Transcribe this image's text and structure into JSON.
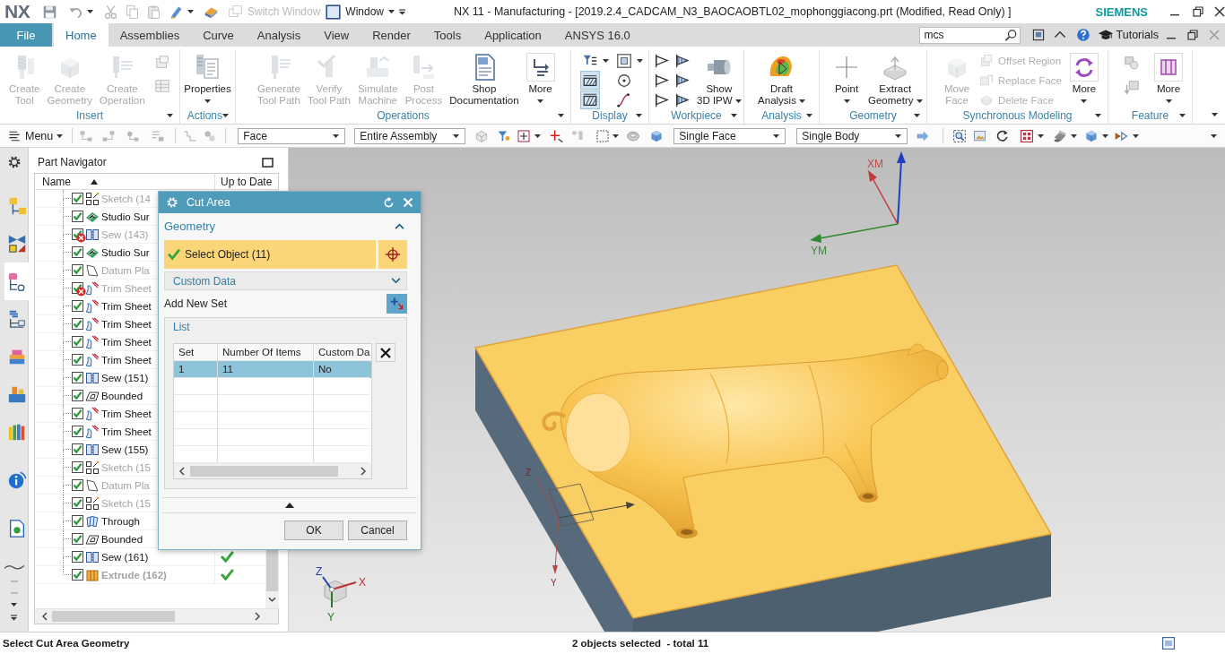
{
  "title_bar": {
    "logo": "NX",
    "switch_window": {
      "label": "Switch Window",
      "disabled": true
    },
    "window_menu": "Window",
    "title": "NX 11 - Manufacturing - [2019.2.4_CADCAM_N3_BAOCAOBTL02_mophonggiacong.prt (Modified, Read Only) ]",
    "brand": "SIEMENS"
  },
  "menu_tabs": [
    {
      "label": "File",
      "kind": "file",
      "selected": false
    },
    {
      "label": "Home",
      "kind": "tab",
      "selected": true
    },
    {
      "label": "Assemblies",
      "kind": "tab",
      "selected": false
    },
    {
      "label": "Curve",
      "kind": "tab",
      "selected": false
    },
    {
      "label": "Analysis",
      "kind": "tab",
      "selected": false
    },
    {
      "label": "View",
      "kind": "tab",
      "selected": false
    },
    {
      "label": "Render",
      "kind": "tab",
      "selected": false
    },
    {
      "label": "Tools",
      "kind": "tab",
      "selected": false
    },
    {
      "label": "Application",
      "kind": "tab",
      "selected": false
    },
    {
      "label": "ANSYS 16.0",
      "kind": "tab",
      "selected": false
    }
  ],
  "command_search": {
    "value": "mcs"
  },
  "help_bar": {
    "tutorials": "Tutorials"
  },
  "ribbon": {
    "groups": [
      {
        "label": "Insert",
        "buttons": [
          {
            "label": "Create\nTool",
            "kind": "large",
            "disabled": true
          },
          {
            "label": "Create\nGeometry",
            "kind": "large",
            "disabled": true
          },
          {
            "label": "Create\nOperation",
            "kind": "large",
            "disabled": true
          }
        ]
      },
      {
        "label": "Actions",
        "buttons": [
          {
            "label": "Properties",
            "kind": "large",
            "disabled": false
          }
        ]
      },
      {
        "label": "Operations",
        "buttons": [
          {
            "label": "Generate\nTool Path",
            "kind": "large",
            "disabled": true
          },
          {
            "label": "Verify\nTool Path",
            "kind": "large",
            "disabled": true
          },
          {
            "label": "Simulate\nMachine",
            "kind": "large",
            "disabled": true
          },
          {
            "label": "Post\nProcess",
            "kind": "large",
            "disabled": true
          },
          {
            "label": "Shop\nDocumentation",
            "kind": "large",
            "disabled": false
          },
          {
            "label": "More",
            "kind": "large",
            "disabled": false
          }
        ]
      },
      {
        "label": "Display",
        "toggles": [
          {
            "on": false
          },
          {
            "on": false
          },
          {
            "on": true
          },
          {
            "on": false
          },
          {
            "on": true
          },
          {
            "on": false
          }
        ]
      },
      {
        "label": "Workpiece",
        "buttons": [
          {
            "label": "Show\n3D IPW",
            "kind": "large",
            "disabled": false
          }
        ]
      },
      {
        "label": "Analysis",
        "buttons": [
          {
            "label": "Draft\nAnalysis",
            "kind": "large",
            "disabled": false
          }
        ]
      },
      {
        "label": "Geometry",
        "buttons": [
          {
            "label": "Point",
            "kind": "large",
            "disabled": false
          },
          {
            "label": "Extract\nGeometry",
            "kind": "large",
            "disabled": false
          }
        ]
      },
      {
        "label": "Synchronous Modeling",
        "buttons": [
          {
            "label": "Move\nFace",
            "kind": "large",
            "disabled": true
          },
          {
            "label": "Offset Region",
            "kind": "small",
            "disabled": true
          },
          {
            "label": "Replace Face",
            "kind": "small",
            "disabled": true
          },
          {
            "label": "Delete Face",
            "kind": "small",
            "disabled": true
          },
          {
            "label": "More",
            "kind": "large",
            "disabled": false
          }
        ]
      },
      {
        "label": "Feature",
        "buttons": [
          {
            "label": "More",
            "kind": "large",
            "disabled": false
          }
        ]
      }
    ]
  },
  "selection_bar": {
    "menu": "Menu",
    "filters": [
      "Face",
      "Entire Assembly",
      "Single Face",
      "Single Body"
    ]
  },
  "resource_bar": {
    "tabs": [
      {
        "selected": false
      },
      {
        "selected": false
      },
      {
        "selected": true
      },
      {
        "selected": false
      },
      {
        "selected": false
      },
      {
        "selected": false
      },
      {
        "selected": false
      },
      {
        "selected": false
      },
      {
        "selected": false
      }
    ]
  },
  "part_navigator": {
    "title": "Part Navigator",
    "columns": [
      {
        "label": "Name",
        "sorted": true
      },
      {
        "label": "Up to Date",
        "sorted": false
      }
    ],
    "rows": [
      {
        "name": "Sketch (14",
        "kind": "sketch",
        "checked": true,
        "error": false,
        "dimmed": true,
        "current": false,
        "up_to_date": false
      },
      {
        "name": "Studio Sur",
        "kind": "studio-surface",
        "checked": true,
        "error": false,
        "dimmed": false,
        "current": false,
        "up_to_date": false
      },
      {
        "name": "Sew (143)",
        "kind": "sew",
        "checked": true,
        "error": true,
        "dimmed": true,
        "current": false,
        "up_to_date": false
      },
      {
        "name": "Studio Sur",
        "kind": "studio-surface",
        "checked": true,
        "error": false,
        "dimmed": false,
        "current": false,
        "up_to_date": false
      },
      {
        "name": "Datum Pla",
        "kind": "datum-plane",
        "checked": true,
        "error": false,
        "dimmed": true,
        "current": false,
        "up_to_date": false
      },
      {
        "name": "Trim Sheet",
        "kind": "trim-sheet",
        "checked": true,
        "error": true,
        "dimmed": true,
        "current": false,
        "up_to_date": false
      },
      {
        "name": "Trim Sheet",
        "kind": "trim-sheet",
        "checked": true,
        "error": false,
        "dimmed": false,
        "current": false,
        "up_to_date": false
      },
      {
        "name": "Trim Sheet",
        "kind": "trim-sheet",
        "checked": true,
        "error": false,
        "dimmed": false,
        "current": false,
        "up_to_date": false
      },
      {
        "name": "Trim Sheet",
        "kind": "trim-sheet",
        "checked": true,
        "error": false,
        "dimmed": false,
        "current": false,
        "up_to_date": false
      },
      {
        "name": "Trim Sheet",
        "kind": "trim-sheet",
        "checked": true,
        "error": false,
        "dimmed": false,
        "current": false,
        "up_to_date": false
      },
      {
        "name": "Sew (151)",
        "kind": "sew",
        "checked": true,
        "error": false,
        "dimmed": false,
        "current": false,
        "up_to_date": false
      },
      {
        "name": "Bounded",
        "kind": "bounded-plane",
        "checked": true,
        "error": false,
        "dimmed": false,
        "current": false,
        "up_to_date": false
      },
      {
        "name": "Trim Sheet",
        "kind": "trim-sheet",
        "checked": true,
        "error": false,
        "dimmed": false,
        "current": false,
        "up_to_date": false
      },
      {
        "name": "Trim Sheet",
        "kind": "trim-sheet",
        "checked": true,
        "error": false,
        "dimmed": false,
        "current": false,
        "up_to_date": false
      },
      {
        "name": "Sew (155)",
        "kind": "sew",
        "checked": true,
        "error": false,
        "dimmed": false,
        "current": false,
        "up_to_date": false
      },
      {
        "name": "Sketch (15",
        "kind": "sketch",
        "checked": true,
        "error": false,
        "dimmed": true,
        "current": false,
        "up_to_date": false
      },
      {
        "name": "Datum Pla",
        "kind": "datum-plane",
        "checked": true,
        "error": false,
        "dimmed": true,
        "current": false,
        "up_to_date": false
      },
      {
        "name": "Sketch (15",
        "kind": "sketch",
        "checked": true,
        "error": false,
        "dimmed": true,
        "current": false,
        "up_to_date": false
      },
      {
        "name": "Through",
        "kind": "through-curves",
        "checked": true,
        "error": false,
        "dimmed": false,
        "current": false,
        "up_to_date": false
      },
      {
        "name": "Bounded",
        "kind": "bounded-plane",
        "checked": true,
        "error": false,
        "dimmed": false,
        "current": false,
        "up_to_date": false
      },
      {
        "name": "Sew (161)",
        "kind": "sew",
        "checked": true,
        "error": false,
        "dimmed": false,
        "current": false,
        "up_to_date": true
      },
      {
        "name": "Extrude (162)",
        "kind": "extrude",
        "checked": true,
        "error": false,
        "dimmed": true,
        "current": true,
        "up_to_date": true
      }
    ]
  },
  "dialog": {
    "title": "Cut Area",
    "geometry": {
      "title": "Geometry",
      "expanded": true,
      "select_object": {
        "label": "Select Object (11)",
        "done": true
      },
      "custom_data": {
        "title": "Custom Data",
        "expanded": false
      },
      "add_new_set": "Add New Set",
      "list": {
        "title": "List",
        "columns": [
          "Set",
          "Number Of Items",
          "Custom Da"
        ],
        "rows": [
          {
            "cells": [
              "1",
              "11",
              "No"
            ],
            "selected": true
          }
        ]
      }
    },
    "buttons": [
      "OK",
      "Cancel"
    ]
  },
  "graphics": {
    "mcs_labels": [
      "XM",
      "YM"
    ],
    "wcs_labels": [
      "Z",
      "Y"
    ],
    "triad_labels": [
      "Z",
      "X",
      "Y"
    ]
  },
  "status_bar": {
    "prompt": "Select Cut Area Geometry",
    "selection": "2 objects selected  - total 11"
  }
}
